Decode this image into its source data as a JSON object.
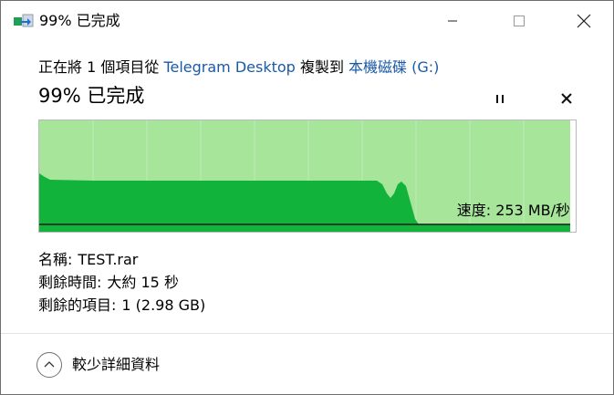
{
  "window": {
    "title": "99% 已完成"
  },
  "copy": {
    "prefix": "正在將 1 個項目從",
    "source": "Telegram Desktop",
    "middle": "複製到",
    "destination": "本機磁碟 (G:)"
  },
  "progress": {
    "percent_text": "99% 已完成",
    "fraction": 0.99
  },
  "graph": {
    "speed_label": "速度: 253 MB/秒",
    "colors": {
      "filled": "#a6e59a",
      "throughput": "#12b33a",
      "grid": "#d4f0cc",
      "speed_line": "#1a1a1a"
    }
  },
  "details": {
    "name_label": "名稱:",
    "name_value": "TEST.rar",
    "time_label": "剩餘時間:",
    "time_value": "大約 15 秒",
    "items_label": "剩餘的項目:",
    "items_value": "1 (2.98 GB)"
  },
  "footer": {
    "more_details": "較少詳細資料"
  }
}
